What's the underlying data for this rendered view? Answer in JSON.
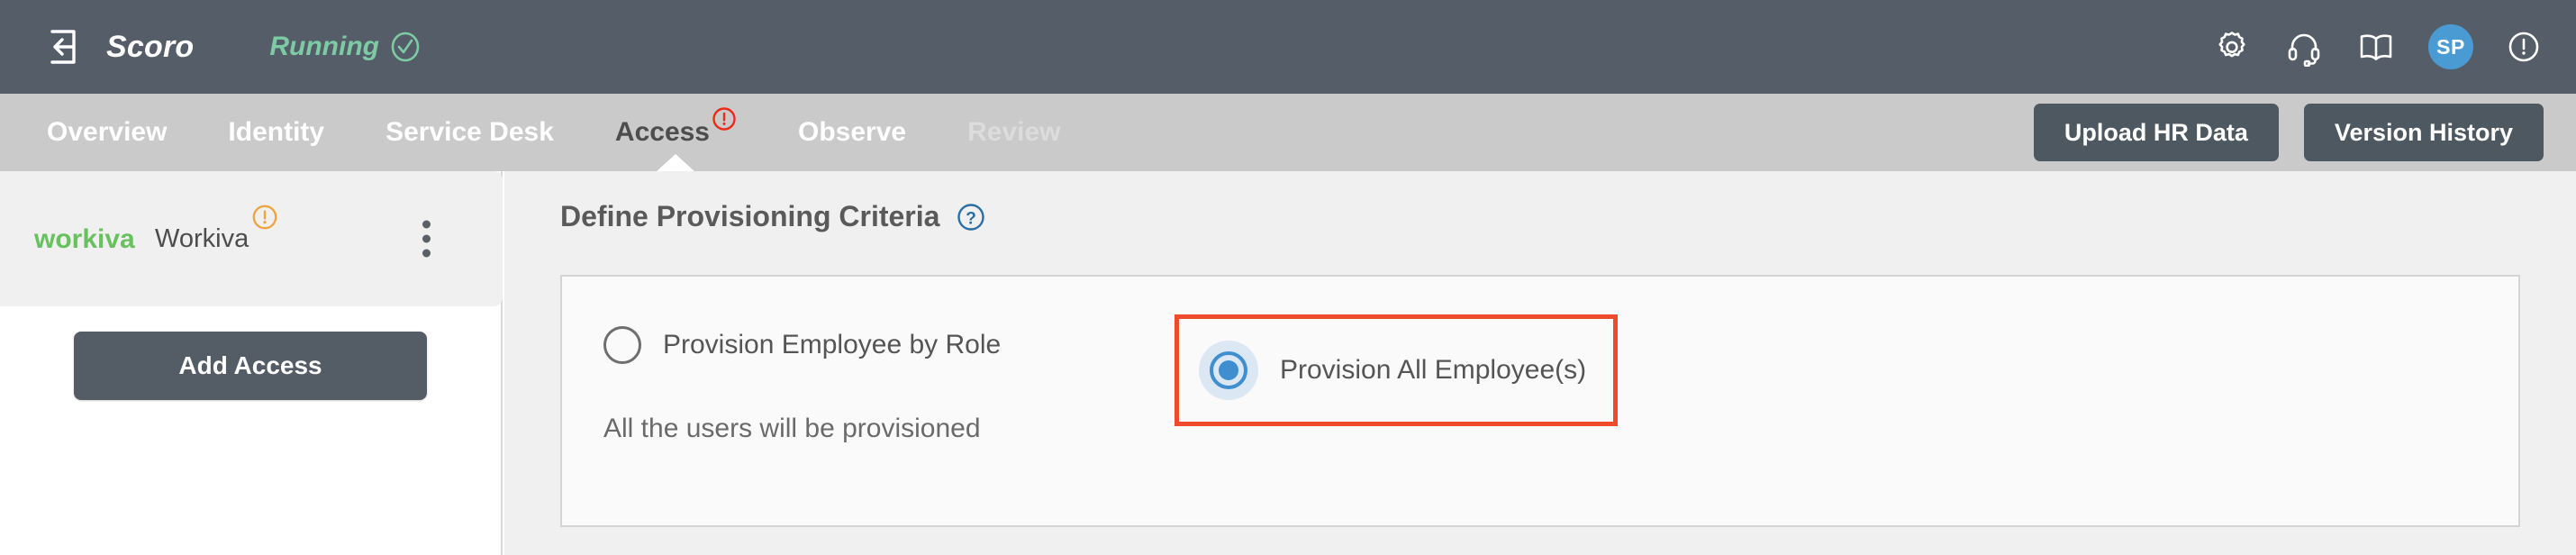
{
  "topbar": {
    "exit_icon": "exit-left-icon",
    "brand": "Scoro",
    "status_label": "Running",
    "status_icon": "check-circle-icon",
    "status_color": "#7dcba4",
    "icons": [
      {
        "name": "gear-icon",
        "label": "Settings"
      },
      {
        "name": "headset-icon",
        "label": "Support"
      },
      {
        "name": "book-icon",
        "label": "Documentation"
      }
    ],
    "avatar_initials": "SP",
    "avatar_color": "#4a9ad4",
    "alert_icon": "exclamation-circle-icon"
  },
  "nav": {
    "tabs": [
      {
        "label": "Overview",
        "state": "normal",
        "badge": null
      },
      {
        "label": "Identity",
        "state": "normal",
        "badge": null
      },
      {
        "label": "Service Desk",
        "state": "normal",
        "badge": null
      },
      {
        "label": "Access",
        "state": "active",
        "badge": "alert"
      },
      {
        "label": "Observe",
        "state": "normal",
        "badge": null
      },
      {
        "label": "Review",
        "state": "disabled",
        "badge": null
      }
    ],
    "badge_color": "#ee2b18",
    "actions": [
      {
        "label": "Upload HR Data",
        "name": "upload-hr-data-button"
      },
      {
        "label": "Version History",
        "name": "version-history-button"
      }
    ]
  },
  "sidebar": {
    "app": {
      "logo_text": "workiva",
      "logo_color": "#67c15e",
      "name": "Workiva",
      "warning_icon": "exclamation-circle-icon",
      "warning_color": "#f0a33c",
      "menu_icon": "kebab-menu-icon"
    },
    "add_access_label": "Add Access"
  },
  "main": {
    "title": "Define Provisioning Criteria",
    "help_icon": "question-circle-icon",
    "help_icon_color": "#2c6ea4",
    "options": [
      {
        "label": "Provision Employee by Role",
        "selected": false,
        "highlighted": false
      },
      {
        "label": "Provision All Employee(s)",
        "selected": true,
        "highlighted": true
      }
    ],
    "note": "All the users will be provisioned",
    "highlight_color": "#ee4b2b",
    "selected_color": "#3f8ed0"
  }
}
